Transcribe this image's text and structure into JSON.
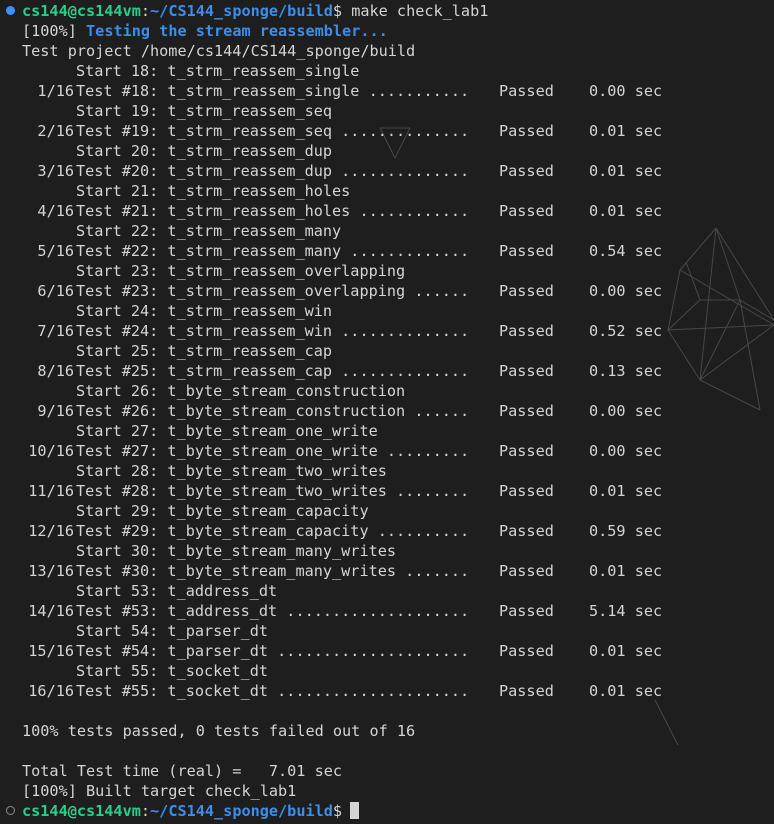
{
  "terminal": {
    "header": {
      "user_host": "cs144@cs144vm",
      "separator": ":",
      "path": "~/CS144_sponge/build",
      "dollar": "$",
      "command": " make check_lab1"
    },
    "progress_prefix": "[100%]",
    "testing_msg": "Testing the stream reassembler...",
    "project_line": "Test project /home/cs144/CS144_sponge/build",
    "tests": [
      {
        "start": "Start 18: t_strm_reassem_single",
        "num": "1/16",
        "body": "Test #18: t_strm_reassem_single ...........",
        "status": "Passed",
        "time": "0.00 sec"
      },
      {
        "start": "Start 19: t_strm_reassem_seq",
        "num": "2/16",
        "body": "Test #19: t_strm_reassem_seq ..............",
        "status": "Passed",
        "time": "0.01 sec"
      },
      {
        "start": "Start 20: t_strm_reassem_dup",
        "num": "3/16",
        "body": "Test #20: t_strm_reassem_dup ..............",
        "status": "Passed",
        "time": "0.01 sec"
      },
      {
        "start": "Start 21: t_strm_reassem_holes",
        "num": "4/16",
        "body": "Test #21: t_strm_reassem_holes ............",
        "status": "Passed",
        "time": "0.01 sec"
      },
      {
        "start": "Start 22: t_strm_reassem_many",
        "num": "5/16",
        "body": "Test #22: t_strm_reassem_many .............",
        "status": "Passed",
        "time": "0.54 sec"
      },
      {
        "start": "Start 23: t_strm_reassem_overlapping",
        "num": "6/16",
        "body": "Test #23: t_strm_reassem_overlapping ......",
        "status": "Passed",
        "time": "0.00 sec"
      },
      {
        "start": "Start 24: t_strm_reassem_win",
        "num": "7/16",
        "body": "Test #24: t_strm_reassem_win ..............",
        "status": "Passed",
        "time": "0.52 sec"
      },
      {
        "start": "Start 25: t_strm_reassem_cap",
        "num": "8/16",
        "body": "Test #25: t_strm_reassem_cap ..............",
        "status": "Passed",
        "time": "0.13 sec"
      },
      {
        "start": "Start 26: t_byte_stream_construction",
        "num": "9/16",
        "body": "Test #26: t_byte_stream_construction ......",
        "status": "Passed",
        "time": "0.00 sec"
      },
      {
        "start": "Start 27: t_byte_stream_one_write",
        "num": "10/16",
        "body": "Test #27: t_byte_stream_one_write .........",
        "status": "Passed",
        "time": "0.00 sec"
      },
      {
        "start": "Start 28: t_byte_stream_two_writes",
        "num": "11/16",
        "body": "Test #28: t_byte_stream_two_writes ........",
        "status": "Passed",
        "time": "0.01 sec"
      },
      {
        "start": "Start 29: t_byte_stream_capacity",
        "num": "12/16",
        "body": "Test #29: t_byte_stream_capacity ..........",
        "status": "Passed",
        "time": "0.59 sec"
      },
      {
        "start": "Start 30: t_byte_stream_many_writes",
        "num": "13/16",
        "body": "Test #30: t_byte_stream_many_writes .......",
        "status": "Passed",
        "time": "0.01 sec"
      },
      {
        "start": "Start 53: t_address_dt",
        "num": "14/16",
        "body": "Test #53: t_address_dt ....................",
        "status": "Passed",
        "time": "5.14 sec"
      },
      {
        "start": "Start 54: t_parser_dt",
        "num": "15/16",
        "body": "Test #54: t_parser_dt .....................",
        "status": "Passed",
        "time": "0.01 sec"
      },
      {
        "start": "Start 55: t_socket_dt",
        "num": "16/16",
        "body": "Test #55: t_socket_dt .....................",
        "status": "Passed",
        "time": "0.01 sec"
      }
    ],
    "summary": "100% tests passed, 0 tests failed out of 16",
    "total_time": "Total Test time (real) =   7.01 sec",
    "built_target": "[100%] Built target check_lab1",
    "prompt": {
      "user_host": "cs144@cs144vm",
      "separator": ":",
      "path": "~/CS144_sponge/build",
      "dollar": "$"
    }
  },
  "colors": {
    "background": "#1e1e1e",
    "text": "#d4d4d4",
    "user_host": "#23d18b",
    "path": "#3b8eea",
    "status_dot": "#3794ff"
  },
  "icons": {
    "command_status_icon": "filled-circle",
    "prompt_status_icon": "hollow-circle"
  }
}
